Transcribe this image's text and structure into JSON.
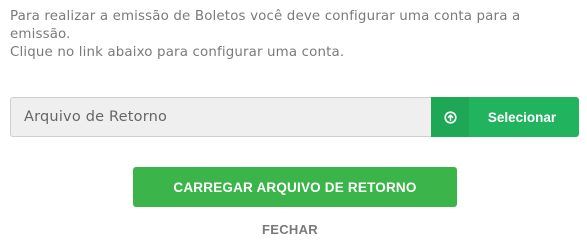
{
  "message": {
    "line1": "Para realizar a emissão de Boletos você deve configurar uma conta para a emissão.",
    "line2": "Clique no link abaixo para configurar uma conta."
  },
  "file_input": {
    "placeholder": "Arquivo de Retorno",
    "select_label": "Selecionar",
    "select_icon": "upload-circle-icon"
  },
  "actions": {
    "upload_label": "CARREGAR ARQUIVO DE RETORNO",
    "close_label": "FECHAR"
  },
  "colors": {
    "select_button": "#22b35e",
    "select_icon_bg": "#1ea754",
    "upload_button": "#3bb54a",
    "text": "#7a7a7a"
  }
}
